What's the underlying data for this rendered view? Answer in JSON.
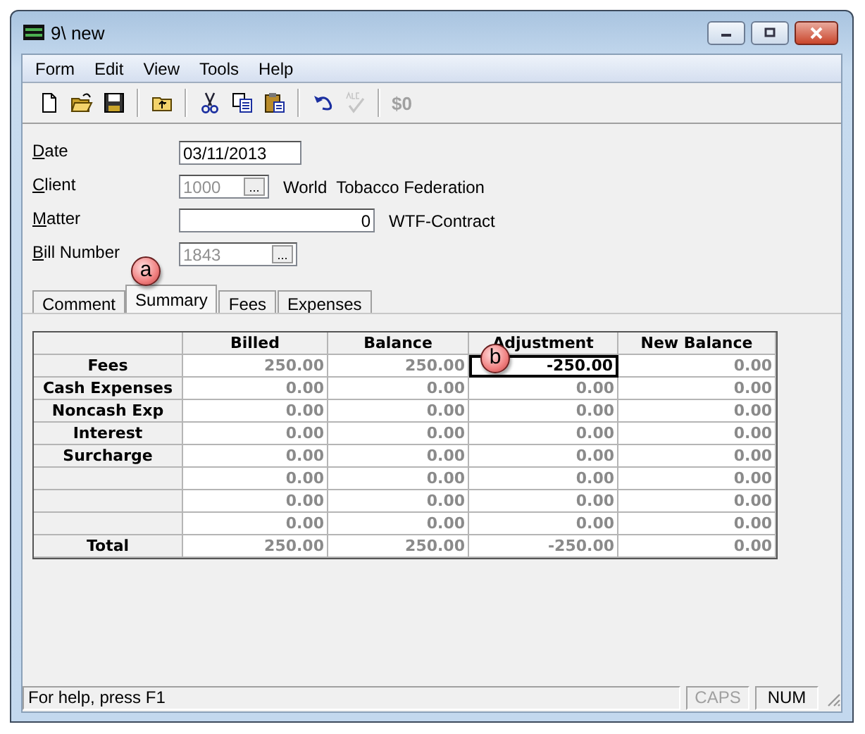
{
  "window": {
    "title": "9\\ new"
  },
  "menu": [
    "Form",
    "Edit",
    "View",
    "Tools",
    "Help"
  ],
  "toolbar": [
    {
      "kind": "button",
      "disabled": false
    },
    {
      "kind": "button",
      "disabled": false
    },
    {
      "kind": "button",
      "disabled": false
    },
    {
      "kind": "separator"
    },
    {
      "kind": "button",
      "disabled": false
    },
    {
      "kind": "separator"
    },
    {
      "kind": "button",
      "disabled": false
    },
    {
      "kind": "button",
      "disabled": false
    },
    {
      "kind": "button",
      "disabled": false
    },
    {
      "kind": "separator"
    },
    {
      "kind": "button",
      "disabled": false
    },
    {
      "kind": "button",
      "disabled": true
    },
    {
      "kind": "separator"
    },
    {
      "kind": "text",
      "label": "$0",
      "disabled": true
    }
  ],
  "form": [
    {
      "label": "Date",
      "kind": "text",
      "value": "03/11/2013",
      "disabled": false
    },
    {
      "label": "Client",
      "kind": "text",
      "value": "1000",
      "disabled": true,
      "browse_button": "...",
      "description": "World  Tobacco Federation"
    },
    {
      "label": "Matter",
      "kind": "number",
      "value": "0",
      "disabled": false,
      "description": "WTF-Contract"
    },
    {
      "label": "Bill Number",
      "kind": "text",
      "value": "1843",
      "disabled": true,
      "browse_button": "..."
    }
  ],
  "tabs": [
    {
      "label": "Comment",
      "selected": false
    },
    {
      "label": "Summary",
      "selected": true
    },
    {
      "label": "Fees",
      "selected": false
    },
    {
      "label": "Expenses",
      "selected": false
    }
  ],
  "table": {
    "columns": [
      "Billed",
      "Balance",
      "Adjustment",
      "New Balance"
    ],
    "rows": [
      {
        "label": "Fees",
        "cells": [
          {
            "text": "250.00",
            "focused": false
          },
          {
            "text": "250.00",
            "focused": false
          },
          {
            "text": "-250.00",
            "focused": true
          },
          {
            "text": "0.00",
            "focused": false
          }
        ]
      },
      {
        "label": "Cash Expenses",
        "cells": [
          {
            "text": "0.00",
            "focused": false
          },
          {
            "text": "0.00",
            "focused": false
          },
          {
            "text": "0.00",
            "focused": false
          },
          {
            "text": "0.00",
            "focused": false
          }
        ]
      },
      {
        "label": "Noncash Exp",
        "cells": [
          {
            "text": "0.00",
            "focused": false
          },
          {
            "text": "0.00",
            "focused": false
          },
          {
            "text": "0.00",
            "focused": false
          },
          {
            "text": "0.00",
            "focused": false
          }
        ]
      },
      {
        "label": "Interest",
        "cells": [
          {
            "text": "0.00",
            "focused": false
          },
          {
            "text": "0.00",
            "focused": false
          },
          {
            "text": "0.00",
            "focused": false
          },
          {
            "text": "0.00",
            "focused": false
          }
        ]
      },
      {
        "label": "Surcharge",
        "cells": [
          {
            "text": "0.00",
            "focused": false
          },
          {
            "text": "0.00",
            "focused": false
          },
          {
            "text": "0.00",
            "focused": false
          },
          {
            "text": "0.00",
            "focused": false
          }
        ]
      },
      {
        "cells": [
          {
            "text": "0.00",
            "focused": false
          },
          {
            "text": "0.00",
            "focused": false
          },
          {
            "text": "0.00",
            "focused": false
          },
          {
            "text": "0.00",
            "focused": false
          }
        ]
      },
      {
        "cells": [
          {
            "text": "0.00",
            "focused": false
          },
          {
            "text": "0.00",
            "focused": false
          },
          {
            "text": "0.00",
            "focused": false
          },
          {
            "text": "0.00",
            "focused": false
          }
        ]
      },
      {
        "cells": [
          {
            "text": "0.00",
            "focused": false
          },
          {
            "text": "0.00",
            "focused": false
          },
          {
            "text": "0.00",
            "focused": false
          },
          {
            "text": "0.00",
            "focused": false
          }
        ]
      },
      {
        "label": "Total",
        "cells": [
          {
            "text": "250.00",
            "focused": false
          },
          {
            "text": "250.00",
            "focused": false
          },
          {
            "text": "-250.00",
            "focused": false
          },
          {
            "text": "0.00",
            "focused": false
          }
        ]
      }
    ]
  },
  "callouts": [
    "a",
    "b"
  ],
  "status_bar": {
    "text": "For help, press F1",
    "indicators": [
      {
        "label": "CAPS",
        "on": false
      },
      {
        "label": "NUM",
        "on": true
      }
    ]
  }
}
